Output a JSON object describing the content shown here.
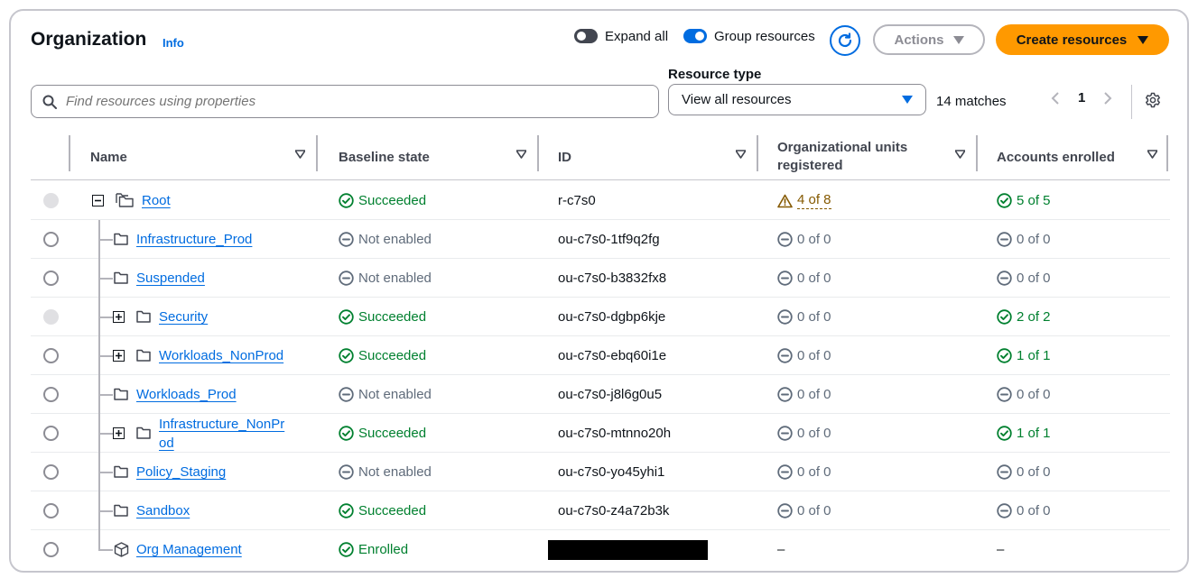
{
  "header": {
    "title": "Organization",
    "info": "Info",
    "expand_all_label": "Expand all",
    "expand_all_on": false,
    "group_resources_label": "Group resources",
    "group_resources_on": true,
    "actions_label": "Actions",
    "create_label": "Create resources"
  },
  "filters": {
    "search_placeholder": "Find resources using properties",
    "resource_type_label": "Resource type",
    "resource_type_value": "View all resources",
    "matches": "14 matches",
    "page": "1"
  },
  "columns": {
    "name": "Name",
    "baseline": "Baseline state",
    "id": "ID",
    "ous": "Organizational units registered",
    "accounts": "Accounts enrolled"
  },
  "rows": [
    {
      "name": "Root",
      "type": "root",
      "expander": "minus",
      "radio": "disabled",
      "baseline": "Succeeded",
      "baseline_status": "success",
      "id": "r-c7s0",
      "ous": "4 of 8",
      "ous_status": "warning",
      "accounts": "5 of 5",
      "accounts_status": "success"
    },
    {
      "name": "Infrastructure_Prod",
      "type": "ou",
      "expander": "",
      "radio": "enabled",
      "baseline": "Not enabled",
      "baseline_status": "disabled",
      "id": "ou-c7s0-1tf9q2fg",
      "ous": "0 of 0",
      "ous_status": "neutral",
      "accounts": "0 of 0",
      "accounts_status": "neutral"
    },
    {
      "name": "Suspended",
      "type": "ou",
      "expander": "",
      "radio": "enabled",
      "baseline": "Not enabled",
      "baseline_status": "disabled",
      "id": "ou-c7s0-b3832fx8",
      "ous": "0 of 0",
      "ous_status": "neutral",
      "accounts": "0 of 0",
      "accounts_status": "neutral"
    },
    {
      "name": "Security",
      "type": "ou",
      "expander": "plus",
      "radio": "disabled",
      "baseline": "Succeeded",
      "baseline_status": "success",
      "id": "ou-c7s0-dgbp6kje",
      "ous": "0 of 0",
      "ous_status": "neutral",
      "accounts": "2 of 2",
      "accounts_status": "success"
    },
    {
      "name": "Workloads_NonProd",
      "type": "ou",
      "expander": "plus",
      "radio": "enabled",
      "baseline": "Succeeded",
      "baseline_status": "success",
      "id": "ou-c7s0-ebq60i1e",
      "ous": "0 of 0",
      "ous_status": "neutral",
      "accounts": "1 of 1",
      "accounts_status": "success"
    },
    {
      "name": "Workloads_Prod",
      "type": "ou",
      "expander": "",
      "radio": "enabled",
      "baseline": "Not enabled",
      "baseline_status": "disabled",
      "id": "ou-c7s0-j8l6g0u5",
      "ous": "0 of 0",
      "ous_status": "neutral",
      "accounts": "0 of 0",
      "accounts_status": "neutral"
    },
    {
      "name": "Infrastructure_NonPr od",
      "type": "ou",
      "expander": "plus",
      "radio": "enabled",
      "baseline": "Succeeded",
      "baseline_status": "success",
      "id": "ou-c7s0-mtnno20h",
      "ous": "0 of 0",
      "ous_status": "neutral",
      "accounts": "1 of 1",
      "accounts_status": "success"
    },
    {
      "name": "Policy_Staging",
      "type": "ou",
      "expander": "",
      "radio": "enabled",
      "baseline": "Not enabled",
      "baseline_status": "disabled",
      "id": "ou-c7s0-yo45yhi1",
      "ous": "0 of 0",
      "ous_status": "neutral",
      "accounts": "0 of 0",
      "accounts_status": "neutral"
    },
    {
      "name": "Sandbox",
      "type": "ou",
      "expander": "",
      "radio": "enabled",
      "baseline": "Succeeded",
      "baseline_status": "success",
      "id": "ou-c7s0-z4a72b3k",
      "ous": "0 of 0",
      "ous_status": "neutral",
      "accounts": "0 of 0",
      "accounts_status": "neutral"
    },
    {
      "name": "Org Management",
      "type": "account",
      "expander": "",
      "radio": "enabled",
      "baseline": "Enrolled",
      "baseline_status": "success",
      "id": "",
      "id_redacted": true,
      "ous": "–",
      "ous_status": "none",
      "accounts": "–",
      "accounts_status": "none"
    }
  ],
  "colors": {
    "accent": "#006ce0",
    "primary_button": "#ff9900",
    "success": "#00802f",
    "warning": "#855900",
    "neutral": "#5f6b7a"
  },
  "icons": {
    "success": "check-circle-icon",
    "disabled": "minus-circle-icon",
    "warning": "warning-triangle-icon",
    "ou": "folder-icon",
    "root": "folders-icon",
    "account": "cube-icon"
  }
}
